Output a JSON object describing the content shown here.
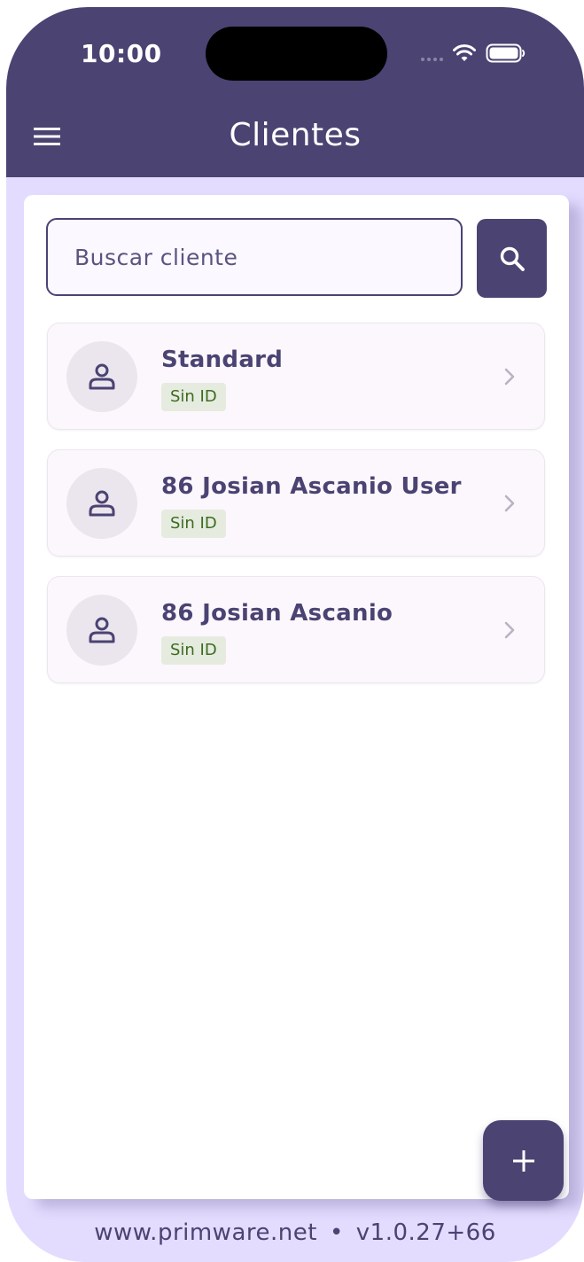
{
  "status_bar": {
    "time": "10:00"
  },
  "header": {
    "title": "Clientes",
    "menu_icon": "hamburger-menu-icon"
  },
  "search": {
    "placeholder": "Buscar cliente",
    "value": "",
    "button_icon": "search-icon"
  },
  "clients": [
    {
      "name": "Standard",
      "badge": "Sin ID"
    },
    {
      "name": "86 Josian Ascanio User",
      "badge": "Sin ID"
    },
    {
      "name": "86 Josian Ascanio",
      "badge": "Sin ID"
    }
  ],
  "fab": {
    "icon": "plus-icon"
  },
  "footer": {
    "website": "www.primware.net",
    "separator": "•",
    "version": "v1.0.27+66"
  },
  "colors": {
    "primary": "#4b4372",
    "background": "#e4dcff",
    "badge_bg": "#e6ebe0",
    "badge_text": "#3c6b1e"
  }
}
